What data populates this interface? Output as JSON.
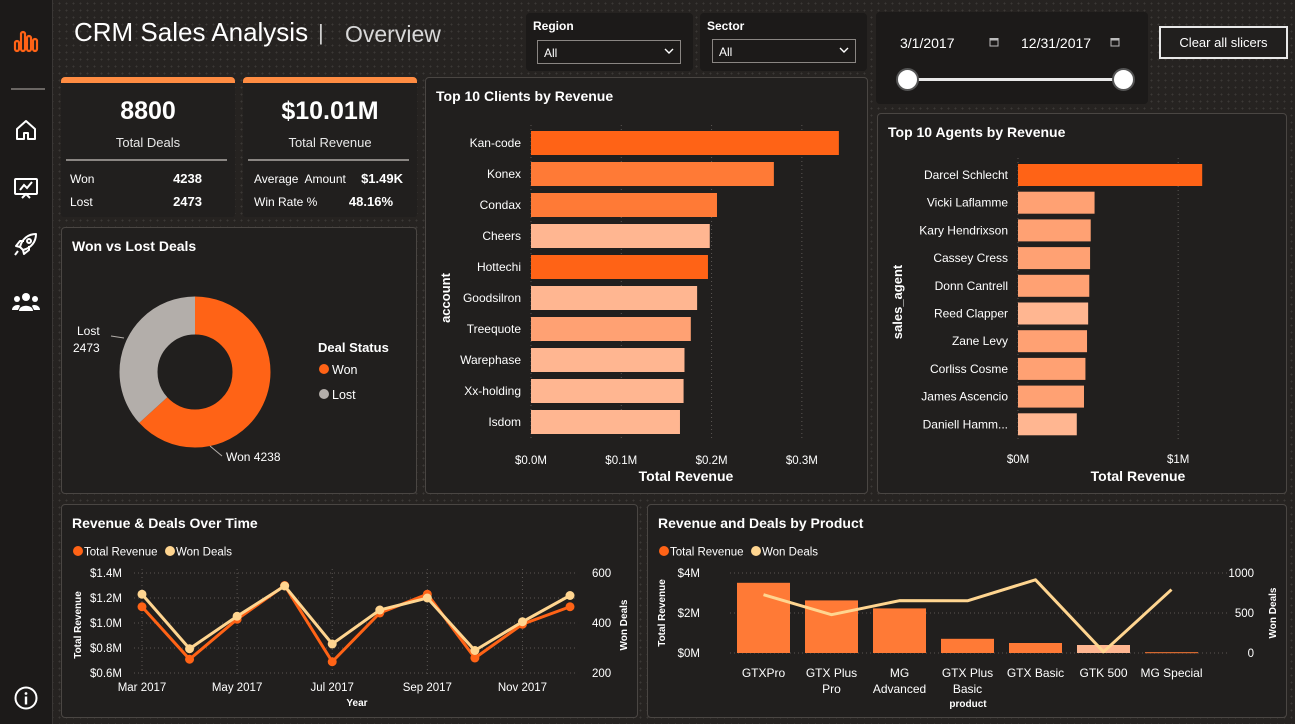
{
  "header": {
    "title": "CRM Sales Analysis",
    "separator": "|",
    "subtitle": "Overview"
  },
  "sidebar": {
    "icons": [
      "bar-chart-logo-icon",
      "home-icon",
      "presentation-icon",
      "rocket-icon",
      "team-icon",
      "info-icon"
    ]
  },
  "slicers": {
    "region": {
      "label": "Region",
      "value": "All"
    },
    "sector": {
      "label": "Sector",
      "value": "All"
    },
    "date": {
      "start": "3/1/2017",
      "end": "12/31/2017"
    },
    "clear_label": "Clear all slicers"
  },
  "kpis": {
    "deals": {
      "value": "8800",
      "label": "Total Deals",
      "won_label": "Won",
      "won": "4238",
      "lost_label": "Lost",
      "lost": "2473"
    },
    "revenue": {
      "value": "$10.01M",
      "label": "Total Revenue",
      "avg_label": "Average  Amount",
      "avg": "$1.49K",
      "winrate_label": "Win Rate %",
      "winrate": "48.16%"
    }
  },
  "colors": {
    "accent": "#ff6316",
    "won": "#ff6316",
    "lost": "#b3aeaa",
    "light_line": "#ffd590",
    "kpi_bar": "#ff8c42"
  },
  "donut": {
    "title": "Won vs Lost Deals",
    "legend_title": "Deal Status",
    "chart_data": {
      "type": "pie",
      "title": "Won vs Lost Deals",
      "slices": [
        {
          "name": "Won",
          "value": 4238
        },
        {
          "name": "Lost",
          "value": 2473
        }
      ],
      "labels": {
        "won": "Won 4238",
        "lost_name": "Lost",
        "lost_value": "2473"
      },
      "legend_placement": "right"
    }
  },
  "clients": {
    "title": "Top 10 Clients by Revenue",
    "chart_data": {
      "type": "bar",
      "orientation": "horizontal",
      "title": "Top 10 Clients by Revenue",
      "ylabel": "account",
      "xlabel": "Total Revenue",
      "categories": [
        "Kan-code",
        "Konex",
        "Condax",
        "Cheers",
        "Hottechi",
        "Goodsilron",
        "Treequote",
        "Warephase",
        "Xx-holding",
        "Isdom"
      ],
      "values": [
        341000,
        269000,
        206000,
        198000,
        196000,
        184000,
        177000,
        170000,
        169000,
        165000
      ],
      "colors": [
        "#ff6316",
        "#ff7a36",
        "#ff7a36",
        "#ffb691",
        "#ff6316",
        "#ffb691",
        "#ffa173",
        "#ffb691",
        "#ffb691",
        "#ffb691"
      ],
      "xticks": [
        "$0.0M",
        "$0.1M",
        "$0.2M",
        "$0.3M"
      ],
      "xlim": [
        0,
        350000
      ]
    }
  },
  "agents": {
    "title": "Top 10 Agents by Revenue",
    "chart_data": {
      "type": "bar",
      "orientation": "horizontal",
      "title": "Top 10 Agents by Revenue",
      "ylabel": "sales_agent",
      "xlabel": "Total Revenue",
      "categories": [
        "Darcel Schlecht",
        "Vicki Laflamme",
        "Kary Hendrixson",
        "Cassey Cress",
        "Donn Cantrell",
        "Reed Clapper",
        "Zane Levy",
        "Corliss Cosme",
        "James Ascencio",
        "Daniell Hamm..."
      ],
      "values": [
        1150000,
        478000,
        454000,
        450000,
        445000,
        438000,
        431000,
        421000,
        412000,
        367000
      ],
      "colors": [
        "#ff6316",
        "#ffa173",
        "#ffa173",
        "#ffa173",
        "#ffa173",
        "#ffb691",
        "#ffa173",
        "#ffa173",
        "#ffa173",
        "#ffb691"
      ],
      "xticks": [
        "$0M",
        "$1M"
      ],
      "xlim": [
        0,
        1180000
      ]
    }
  },
  "timeline": {
    "title": "Revenue & Deals Over Time",
    "chart_data": {
      "type": "line",
      "title": "Revenue & Deals Over Time",
      "xlabel": "Year",
      "ylabel": "Total Revenue",
      "y2label": "Won Deals",
      "x": [
        "Mar 2017",
        "Apr 2017",
        "May 2017",
        "Jun 2017",
        "Jul 2017",
        "Aug 2017",
        "Sep 2017",
        "Oct 2017",
        "Nov 2017",
        "Dec 2017"
      ],
      "xticks": [
        "Mar 2017",
        "May 2017",
        "Jul 2017",
        "Sep 2017",
        "Nov 2017"
      ],
      "series": [
        {
          "name": "Total Revenue",
          "axis": "left",
          "values": [
            1.13,
            0.71,
            1.03,
            1.3,
            0.69,
            1.08,
            1.23,
            0.72,
            0.99,
            1.13
          ]
        },
        {
          "name": "Won Deals",
          "axis": "right",
          "values": [
            515,
            297,
            427,
            548,
            316,
            452,
            500,
            290,
            405,
            510
          ]
        }
      ],
      "yticks": [
        "$0.6M",
        "$0.8M",
        "$1.0M",
        "$1.2M",
        "$1.4M"
      ],
      "ylim": [
        0.6,
        1.4
      ],
      "y2ticks": [
        "200",
        "400",
        "600"
      ],
      "y2lim": [
        200,
        600
      ],
      "legend_placement": "top-left"
    }
  },
  "products": {
    "title": "Revenue and Deals by Product",
    "chart_data": {
      "type": "bar",
      "title": "Revenue and Deals by Product",
      "xlabel": "product",
      "ylabel": "Total Revenue",
      "y2label": "Won Deals",
      "categories": [
        "GTXPro",
        "GTX Plus Pro",
        "MG Advanced",
        "GTX Plus Basic",
        "GTX Basic",
        "GTK 500",
        "MG Special"
      ],
      "category_lines": [
        [
          "GTXPro"
        ],
        [
          "GTX Plus",
          "Pro"
        ],
        [
          "MG",
          "Advanced"
        ],
        [
          "GTX Plus",
          "Basic"
        ],
        [
          "GTX Basic"
        ],
        [
          "GTK 500"
        ],
        [
          "MG Special"
        ]
      ],
      "series": [
        {
          "name": "Total Revenue",
          "type": "bar",
          "axis": "left",
          "values": [
            3.51,
            2.63,
            2.23,
            0.71,
            0.5,
            0.4,
            0.04
          ]
        },
        {
          "name": "Won Deals",
          "type": "line",
          "axis": "right",
          "values": [
            729,
            479,
            654,
            653,
            915,
            15,
            793
          ]
        }
      ],
      "bar_colors": [
        "#ff7a36",
        "#ff7a36",
        "#ff7a36",
        "#ff7a36",
        "#ff7a36",
        "#ffb691",
        "#ff7a36"
      ],
      "yticks": [
        "$0M",
        "$2M",
        "$4M"
      ],
      "ylim": [
        0,
        4
      ],
      "y2ticks": [
        "0",
        "500",
        "1000"
      ],
      "y2lim": [
        0,
        1000
      ],
      "legend_placement": "top-left"
    }
  }
}
